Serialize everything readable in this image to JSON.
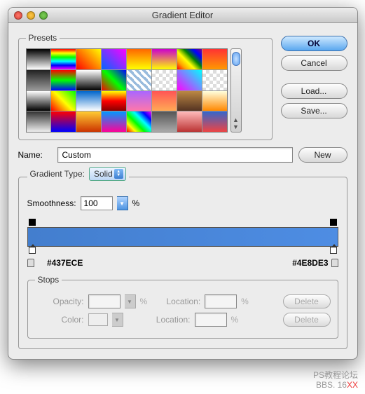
{
  "window": {
    "title": "Gradient Editor"
  },
  "buttons": {
    "ok": "OK",
    "cancel": "Cancel",
    "load": "Load...",
    "save": "Save...",
    "new": "New",
    "delete": "Delete"
  },
  "presets": {
    "legend": "Presets",
    "swatches": [
      "linear-gradient(#000,#fff)",
      "linear-gradient(red,yellow,lime,cyan,blue,magenta)",
      "linear-gradient(45deg,#f00,#ff0)",
      "linear-gradient(45deg,#06f,#f0f)",
      "linear-gradient(#f60,#ff0)",
      "linear-gradient(#c0c,#ff0)",
      "linear-gradient(45deg,red,orange,yellow,green,blue,purple)",
      "linear-gradient(#f33,#f90)",
      "linear-gradient(#222,#999)",
      "linear-gradient(red,lime,blue)",
      "linear-gradient(#fff,#000)",
      "linear-gradient(45deg,#f00,#0f0,#00f)",
      "repeating-linear-gradient(45deg,#9bd,#9bd 4px,#fff 4px,#fff 8px)",
      "repeating-conic-gradient(#ddd 0 25%,#fff 0 50%)",
      "linear-gradient(45deg,#f0f,#0ff)",
      "repeating-conic-gradient(#ddd 0 25%,#fff 0 50%)",
      "linear-gradient(#fff,#000)",
      "linear-gradient(45deg,#f00,#ff0,#0f0)",
      "linear-gradient(#06c,#fff)",
      "linear-gradient(#ff0,#f00,#800)",
      "linear-gradient(#a6f,#f7a)",
      "linear-gradient(#f55,#fa5)",
      "linear-gradient(#b84,#532)",
      "linear-gradient(#ffd,#f80)",
      "linear-gradient(#333,#eee)",
      "linear-gradient(#f00,#00f)",
      "linear-gradient(#fc3,#c30)",
      "linear-gradient(#09f,#f09)",
      "linear-gradient(45deg,#f00,#ff0,#0f0,#0ff,#00f,#f0f)",
      "linear-gradient(#555,#aaa)",
      "linear-gradient(#fbb,#b33)",
      "linear-gradient(#36c,#e44)"
    ]
  },
  "name": {
    "label": "Name:",
    "value": "Custom"
  },
  "gradient_type": {
    "legend": "Gradient Type:",
    "value": "Solid"
  },
  "smoothness": {
    "label": "Smoothness:",
    "value": "100",
    "unit": "%"
  },
  "gradient": {
    "left_hex": "#437ECE",
    "right_hex": "#4E8DE3"
  },
  "stops": {
    "legend": "Stops",
    "opacity_label": "Opacity:",
    "opacity_value": "",
    "opacity_unit": "%",
    "location_label": "Location:",
    "location_value": "",
    "location_unit": "%",
    "color_label": "Color:"
  },
  "watermark": {
    "line1": "PS教程论坛",
    "line2_a": "BBS. 16",
    "line2_b": "XX"
  }
}
